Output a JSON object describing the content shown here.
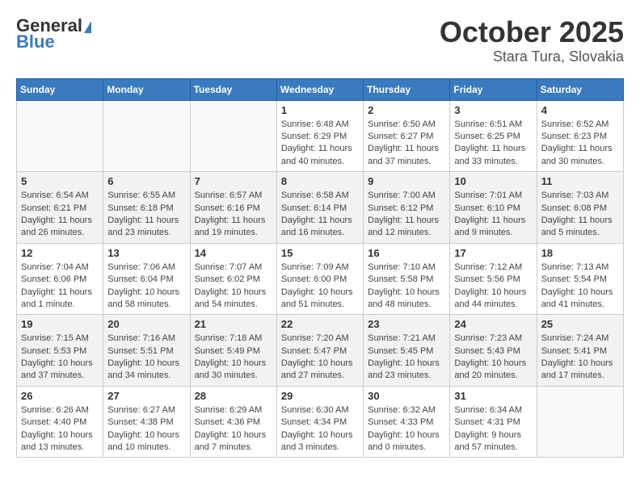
{
  "header": {
    "logo_general": "General",
    "logo_blue": "Blue",
    "month": "October 2025",
    "location": "Stara Tura, Slovakia"
  },
  "weekdays": [
    "Sunday",
    "Monday",
    "Tuesday",
    "Wednesday",
    "Thursday",
    "Friday",
    "Saturday"
  ],
  "weeks": [
    [
      {
        "day": "",
        "info": ""
      },
      {
        "day": "",
        "info": ""
      },
      {
        "day": "",
        "info": ""
      },
      {
        "day": "1",
        "info": "Sunrise: 6:48 AM\nSunset: 6:29 PM\nDaylight: 11 hours\nand 40 minutes."
      },
      {
        "day": "2",
        "info": "Sunrise: 6:50 AM\nSunset: 6:27 PM\nDaylight: 11 hours\nand 37 minutes."
      },
      {
        "day": "3",
        "info": "Sunrise: 6:51 AM\nSunset: 6:25 PM\nDaylight: 11 hours\nand 33 minutes."
      },
      {
        "day": "4",
        "info": "Sunrise: 6:52 AM\nSunset: 6:23 PM\nDaylight: 11 hours\nand 30 minutes."
      }
    ],
    [
      {
        "day": "5",
        "info": "Sunrise: 6:54 AM\nSunset: 6:21 PM\nDaylight: 11 hours\nand 26 minutes."
      },
      {
        "day": "6",
        "info": "Sunrise: 6:55 AM\nSunset: 6:18 PM\nDaylight: 11 hours\nand 23 minutes."
      },
      {
        "day": "7",
        "info": "Sunrise: 6:57 AM\nSunset: 6:16 PM\nDaylight: 11 hours\nand 19 minutes."
      },
      {
        "day": "8",
        "info": "Sunrise: 6:58 AM\nSunset: 6:14 PM\nDaylight: 11 hours\nand 16 minutes."
      },
      {
        "day": "9",
        "info": "Sunrise: 7:00 AM\nSunset: 6:12 PM\nDaylight: 11 hours\nand 12 minutes."
      },
      {
        "day": "10",
        "info": "Sunrise: 7:01 AM\nSunset: 6:10 PM\nDaylight: 11 hours\nand 9 minutes."
      },
      {
        "day": "11",
        "info": "Sunrise: 7:03 AM\nSunset: 6:08 PM\nDaylight: 11 hours\nand 5 minutes."
      }
    ],
    [
      {
        "day": "12",
        "info": "Sunrise: 7:04 AM\nSunset: 6:06 PM\nDaylight: 11 hours\nand 1 minute."
      },
      {
        "day": "13",
        "info": "Sunrise: 7:06 AM\nSunset: 6:04 PM\nDaylight: 10 hours\nand 58 minutes."
      },
      {
        "day": "14",
        "info": "Sunrise: 7:07 AM\nSunset: 6:02 PM\nDaylight: 10 hours\nand 54 minutes."
      },
      {
        "day": "15",
        "info": "Sunrise: 7:09 AM\nSunset: 6:00 PM\nDaylight: 10 hours\nand 51 minutes."
      },
      {
        "day": "16",
        "info": "Sunrise: 7:10 AM\nSunset: 5:58 PM\nDaylight: 10 hours\nand 48 minutes."
      },
      {
        "day": "17",
        "info": "Sunrise: 7:12 AM\nSunset: 5:56 PM\nDaylight: 10 hours\nand 44 minutes."
      },
      {
        "day": "18",
        "info": "Sunrise: 7:13 AM\nSunset: 5:54 PM\nDaylight: 10 hours\nand 41 minutes."
      }
    ],
    [
      {
        "day": "19",
        "info": "Sunrise: 7:15 AM\nSunset: 5:53 PM\nDaylight: 10 hours\nand 37 minutes."
      },
      {
        "day": "20",
        "info": "Sunrise: 7:16 AM\nSunset: 5:51 PM\nDaylight: 10 hours\nand 34 minutes."
      },
      {
        "day": "21",
        "info": "Sunrise: 7:18 AM\nSunset: 5:49 PM\nDaylight: 10 hours\nand 30 minutes."
      },
      {
        "day": "22",
        "info": "Sunrise: 7:20 AM\nSunset: 5:47 PM\nDaylight: 10 hours\nand 27 minutes."
      },
      {
        "day": "23",
        "info": "Sunrise: 7:21 AM\nSunset: 5:45 PM\nDaylight: 10 hours\nand 23 minutes."
      },
      {
        "day": "24",
        "info": "Sunrise: 7:23 AM\nSunset: 5:43 PM\nDaylight: 10 hours\nand 20 minutes."
      },
      {
        "day": "25",
        "info": "Sunrise: 7:24 AM\nSunset: 5:41 PM\nDaylight: 10 hours\nand 17 minutes."
      }
    ],
    [
      {
        "day": "26",
        "info": "Sunrise: 6:26 AM\nSunset: 4:40 PM\nDaylight: 10 hours\nand 13 minutes."
      },
      {
        "day": "27",
        "info": "Sunrise: 6:27 AM\nSunset: 4:38 PM\nDaylight: 10 hours\nand 10 minutes."
      },
      {
        "day": "28",
        "info": "Sunrise: 6:29 AM\nSunset: 4:36 PM\nDaylight: 10 hours\nand 7 minutes."
      },
      {
        "day": "29",
        "info": "Sunrise: 6:30 AM\nSunset: 4:34 PM\nDaylight: 10 hours\nand 3 minutes."
      },
      {
        "day": "30",
        "info": "Sunrise: 6:32 AM\nSunset: 4:33 PM\nDaylight: 10 hours\nand 0 minutes."
      },
      {
        "day": "31",
        "info": "Sunrise: 6:34 AM\nSunset: 4:31 PM\nDaylight: 9 hours\nand 57 minutes."
      },
      {
        "day": "",
        "info": ""
      }
    ]
  ]
}
